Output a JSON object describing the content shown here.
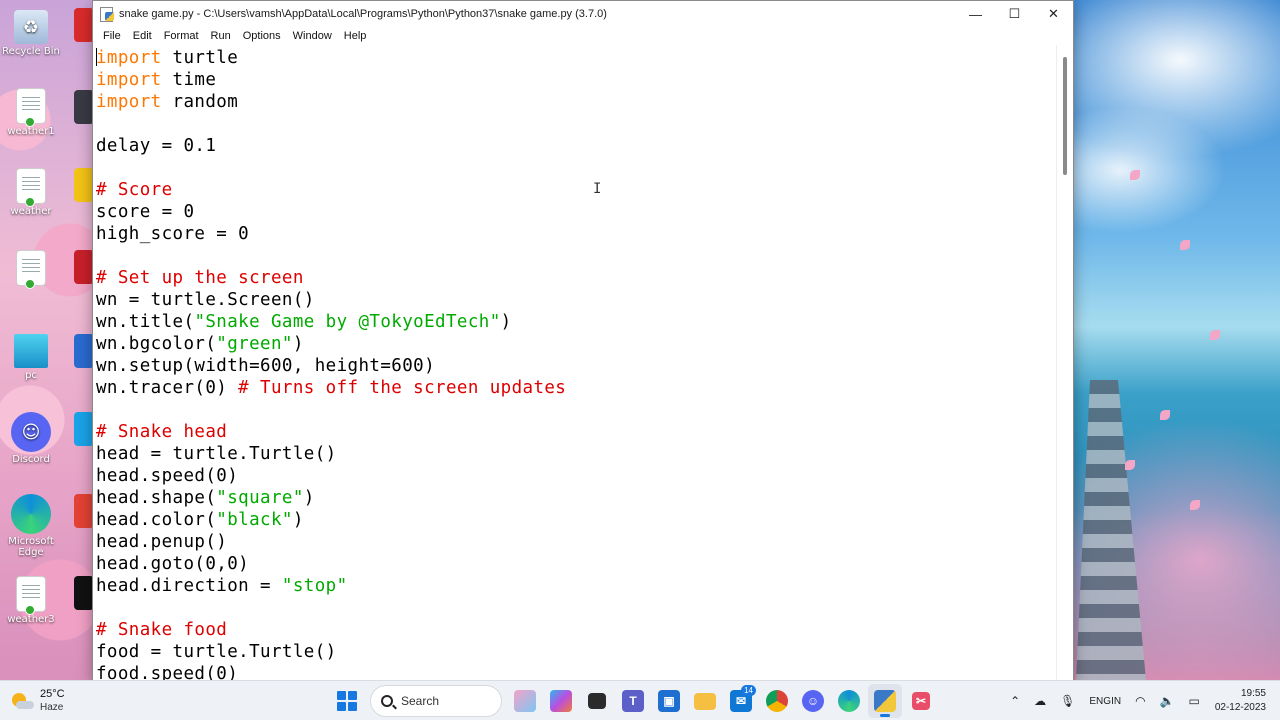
{
  "window": {
    "title": "snake game.py - C:\\Users\\vamsh\\AppData\\Local\\Programs\\Python\\Python37\\snake game.py (3.7.0)",
    "minimize_glyph": "—",
    "maximize_glyph": "☐",
    "close_glyph": "✕"
  },
  "menu": [
    "File",
    "Edit",
    "Format",
    "Run",
    "Options",
    "Window",
    "Help"
  ],
  "code_lines": [
    [
      {
        "t": "import",
        "c": "kw"
      },
      {
        "t": " turtle"
      }
    ],
    [
      {
        "t": "import",
        "c": "kw"
      },
      {
        "t": " time"
      }
    ],
    [
      {
        "t": "import",
        "c": "kw"
      },
      {
        "t": " random"
      }
    ],
    [],
    [
      {
        "t": "delay = 0.1"
      }
    ],
    [],
    [
      {
        "t": "# Score",
        "c": "cm"
      }
    ],
    [
      {
        "t": "score = 0"
      }
    ],
    [
      {
        "t": "high_score = 0"
      }
    ],
    [],
    [
      {
        "t": "# Set up the screen",
        "c": "cm"
      }
    ],
    [
      {
        "t": "wn = turtle.Screen()"
      }
    ],
    [
      {
        "t": "wn.title("
      },
      {
        "t": "\"Snake Game by @TokyoEdTech\"",
        "c": "st"
      },
      {
        "t": ")"
      }
    ],
    [
      {
        "t": "wn.bgcolor("
      },
      {
        "t": "\"green\"",
        "c": "st"
      },
      {
        "t": ")"
      }
    ],
    [
      {
        "t": "wn.setup(width=600, height=600)"
      }
    ],
    [
      {
        "t": "wn.tracer(0) "
      },
      {
        "t": "# Turns off the screen updates",
        "c": "cm"
      }
    ],
    [],
    [
      {
        "t": "# Snake head",
        "c": "cm"
      }
    ],
    [
      {
        "t": "head = turtle.Turtle()"
      }
    ],
    [
      {
        "t": "head.speed(0)"
      }
    ],
    [
      {
        "t": "head.shape("
      },
      {
        "t": "\"square\"",
        "c": "st"
      },
      {
        "t": ")"
      }
    ],
    [
      {
        "t": "head.color("
      },
      {
        "t": "\"black\"",
        "c": "st"
      },
      {
        "t": ")"
      }
    ],
    [
      {
        "t": "head.penup()"
      }
    ],
    [
      {
        "t": "head.goto(0,0)"
      }
    ],
    [
      {
        "t": "head.direction = "
      },
      {
        "t": "\"stop\"",
        "c": "st"
      }
    ],
    [],
    [
      {
        "t": "# Snake food",
        "c": "cm"
      }
    ],
    [
      {
        "t": "food = turtle.Turtle()"
      }
    ],
    [
      {
        "t": "food.speed(0)"
      }
    ]
  ],
  "colors": {
    "keyword": "#ff7700",
    "comment": "#dd0000",
    "string": "#00aa00",
    "accent": "#1678e0"
  },
  "desktop_icons": [
    {
      "label": "Recycle Bin",
      "icon": "recycle-bin-icon"
    },
    {
      "label": "weather1",
      "icon": "document-icon"
    },
    {
      "label": "weather",
      "icon": "document-icon"
    },
    {
      "label": "",
      "icon": "document-icon"
    },
    {
      "label": "pc",
      "icon": "monitor-icon"
    },
    {
      "label": "Discord",
      "icon": "discord-icon"
    },
    {
      "label": "Microsoft Edge",
      "icon": "edge-icon"
    },
    {
      "label": "weather3",
      "icon": "document-icon"
    }
  ],
  "taskbar": {
    "weather_temp": "25°C",
    "weather_condition": "Haze",
    "search_placeholder": "Search",
    "teams_badge": "14",
    "lang_primary": "ENG",
    "lang_secondary": "IN",
    "time": "19:55",
    "date": "02-12-2023",
    "apps": [
      "widgets-icon",
      "copilot-icon",
      "file-explorer-icon",
      "teams-icon",
      "store-icon",
      "folder-icon",
      "mail-icon",
      "chrome-icon",
      "discord-icon",
      "edge-icon",
      "python-icon",
      "snipping-tool-icon"
    ]
  }
}
